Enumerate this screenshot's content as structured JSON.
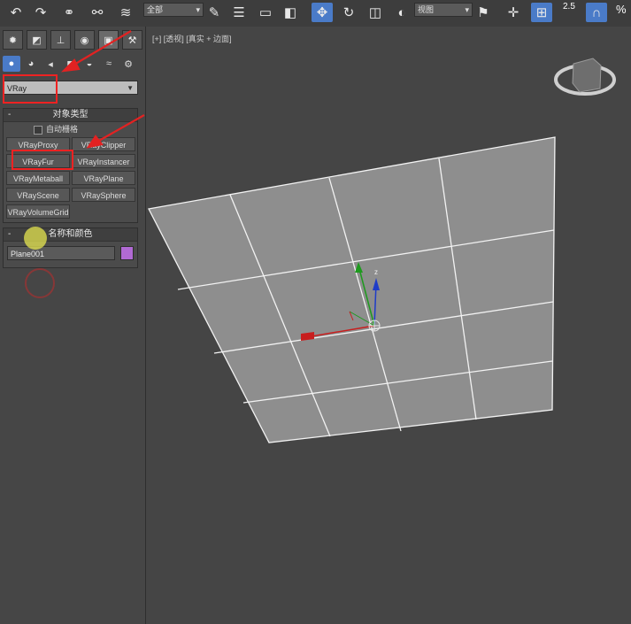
{
  "toolbar": {
    "selection_filter": "全部",
    "view_coord": "视图",
    "snap_badge": "2.5",
    "percent_badge": "%",
    "icons": [
      "undo-icon",
      "redo-icon",
      "link-icon",
      "unlink-icon",
      "bind-space-warp-icon",
      "select-object-icon",
      "select-by-name-icon",
      "rect-selection-icon",
      "window-crossing-icon",
      "move-icon",
      "rotate-icon",
      "scale-icon",
      "use-pivot-center-icon",
      "mirror-icon",
      "align-icon",
      "snap-toggle-icon"
    ]
  },
  "command_panel": {
    "tab_icons": [
      "create-tab-icon",
      "modify-tab-icon",
      "hierarchy-tab-icon",
      "motion-tab-icon",
      "display-tab-icon",
      "utilities-tab-icon"
    ],
    "category_icons": [
      "geometry-icon",
      "shapes-icon",
      "lights-icon",
      "cameras-icon",
      "helpers-icon",
      "space-warps-icon",
      "systems-icon"
    ],
    "category": "VRay",
    "object_type": {
      "title": "对象类型",
      "toggle": "-",
      "autogrid_label": "自动栅格",
      "buttons": [
        "VRayProxy",
        "VRayClipper",
        "VRayFur",
        "VRayInstancer",
        "VRayMetaball",
        "VRayPlane",
        "VRayScene",
        "VRaySphere",
        "VRayVolumeGrid"
      ]
    },
    "name_color": {
      "title": "名称和颜色",
      "toggle": "-",
      "name": "Plane001",
      "color": "#b16ad4"
    }
  },
  "viewport": {
    "label": "[+] [透视] [真实 + 边面]",
    "gizmo_labels": {
      "z": "z",
      "y": "y"
    }
  },
  "annotation_color": "#e22222"
}
